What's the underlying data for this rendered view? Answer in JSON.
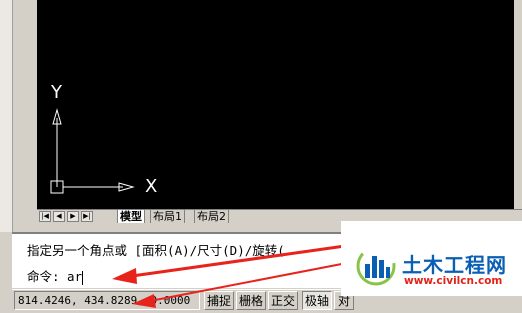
{
  "drawing": {
    "ucs_y_label": "Y",
    "ucs_x_label": "X"
  },
  "layout_tabs": {
    "nav_buttons": [
      "|◀",
      "◀",
      "▶",
      "▶|"
    ],
    "tabs": [
      {
        "label": "模型",
        "active": true
      },
      {
        "label": "布局1",
        "active": false
      },
      {
        "label": "布局2",
        "active": false
      }
    ]
  },
  "command": {
    "history_line": "指定另一个角点或 [面积(A)/尺寸(D)/旋转(",
    "prompt": "命令: ar"
  },
  "status": {
    "coordinates": "814.4246, 434.8289, 0.0000",
    "buttons": [
      {
        "label": "捕捉",
        "pressed": false
      },
      {
        "label": "栅格",
        "pressed": false
      },
      {
        "label": "正交",
        "pressed": false
      },
      {
        "label": "极轴",
        "pressed": true
      },
      {
        "label": "对",
        "pressed": false
      }
    ]
  },
  "annotation": {
    "arrow_color": "#e8231c"
  },
  "watermark": {
    "text": "土木工程网",
    "url": "www.civilcn.com"
  },
  "colors": {
    "drawing_bg": "#000000",
    "ui_face": "#d4d0c8",
    "brand_blue": "#0a5fb4",
    "brand_red": "#e2231a"
  }
}
